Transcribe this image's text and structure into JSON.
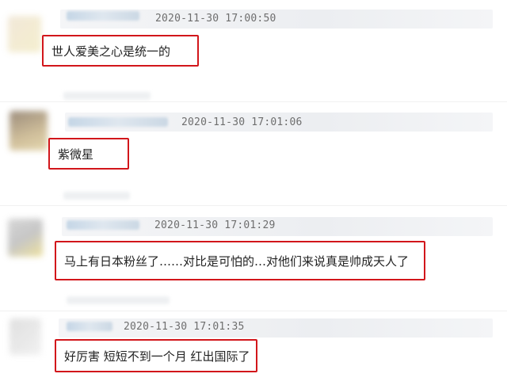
{
  "comments": [
    {
      "timestamp": "2020-11-30 17:00:50",
      "text": "世人爱美之心是统一的",
      "avatar_colors": [
        "#e8dcc8",
        "#f1e9c4"
      ]
    },
    {
      "timestamp": "2020-11-30 17:01:06",
      "text": "紫微星",
      "avatar_colors": [
        "#7a6a58",
        "#d8c48a"
      ]
    },
    {
      "timestamp": "2020-11-30 17:01:29",
      "text": "马上有日本粉丝了……对比是可怕的…对他们来说真是帅成天人了",
      "avatar_colors": [
        "#c9c9c9",
        "#e8dc9a"
      ]
    },
    {
      "timestamp": "2020-11-30 17:01:35",
      "text": "好厉害 短短不到一个月 红出国际了",
      "avatar_colors": [
        "#d4d4d4",
        "#ececec"
      ]
    }
  ],
  "highlight_color": "#d2161b"
}
